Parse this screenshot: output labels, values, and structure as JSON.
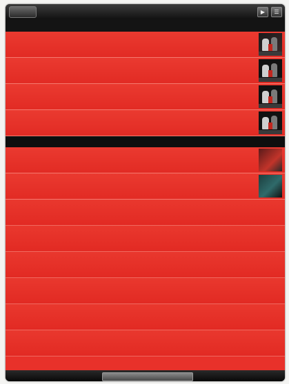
{
  "topbar": {
    "back_label": "",
    "icons": [
      "share-icon",
      "menu-icon"
    ]
  },
  "sections": [
    {
      "header": "",
      "rows": [
        {
          "title": "",
          "subtitle": "",
          "meta": "",
          "thumb": "band-photo"
        },
        {
          "title": "",
          "subtitle": "",
          "meta": "",
          "thumb": "band-photo"
        },
        {
          "title": "",
          "subtitle": "",
          "meta": "",
          "thumb": "band-photo"
        },
        {
          "title": "",
          "subtitle": "",
          "meta": "",
          "thumb": "band-photo"
        }
      ]
    },
    {
      "header": "",
      "rows": [
        {
          "title": "",
          "subtitle": "",
          "meta": "",
          "thumb": "album-art-red"
        },
        {
          "title": "",
          "subtitle": "",
          "meta": "",
          "thumb": "album-art-teal"
        }
      ]
    }
  ],
  "bottombar": {
    "button_label": ""
  },
  "colors": {
    "list_red": "#e8312a",
    "row_divider": "#f57a70",
    "bar_dark": "#101010"
  }
}
